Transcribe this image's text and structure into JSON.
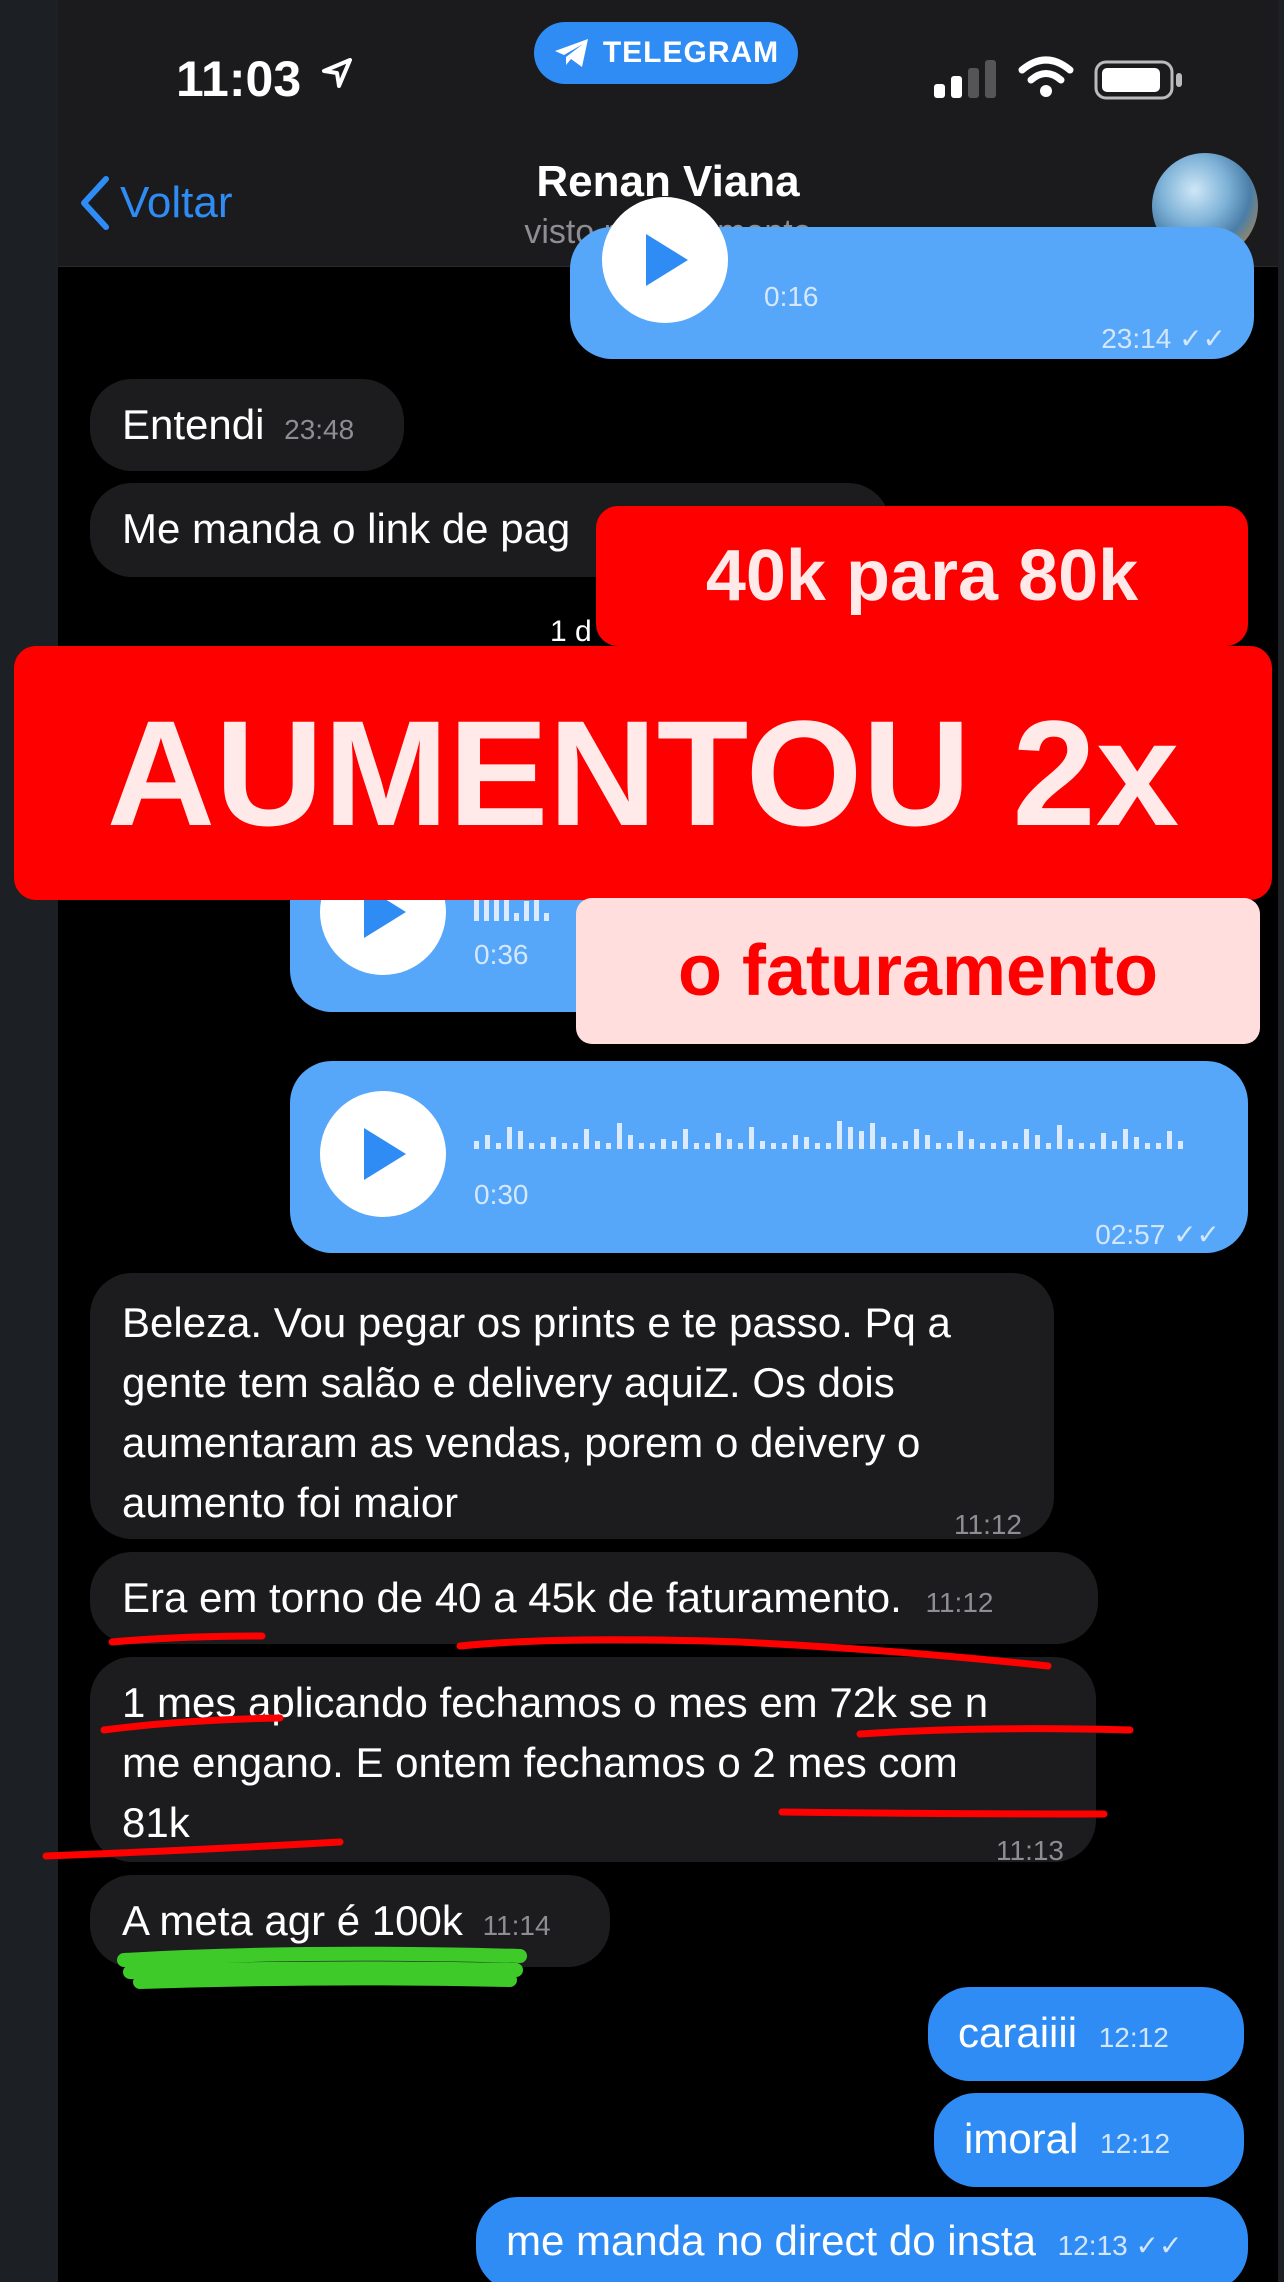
{
  "status_bar": {
    "time": "11:03",
    "telegram_pill": "TELEGRAM"
  },
  "header": {
    "back_label": "Voltar",
    "contact_name": "Renan Viana",
    "contact_status": "visto recentemente"
  },
  "messages": {
    "voice_top": {
      "duration": "0:16",
      "time": "23:14"
    },
    "entendi": {
      "text": "Entendi",
      "time": "23:48"
    },
    "link": {
      "text": "Me manda o link de pag"
    },
    "date_partial": "1 d",
    "voice_a": {
      "duration": "0:36"
    },
    "voice_b": {
      "duration": "0:30",
      "time": "02:57"
    },
    "beleza": {
      "lines": [
        "Beleza. Vou pegar os prints e te passo. Pq a",
        "gente tem salão e delivery aquiZ. Os dois",
        "aumentaram as vendas, porem o deivery o",
        "aumento foi maior"
      ],
      "time": "11:12"
    },
    "era": {
      "text": "Era em torno de 40 a 45k de faturamento.",
      "time": "11:12"
    },
    "mes": {
      "lines": [
        "1 mes aplicando fechamos o mes em 72k se n",
        "me engano. E ontem fechamos o 2 mes com",
        "81k"
      ],
      "time": "11:13"
    },
    "meta": {
      "text": "A meta agr é 100k",
      "time": "11:14"
    },
    "caraiiii": {
      "text": "caraiiii",
      "time": "12:12"
    },
    "imoral": {
      "text": "imoral",
      "time": "12:12"
    },
    "direct": {
      "text": "me manda no direct do insta",
      "time": "12:13"
    }
  },
  "overlay": {
    "top_banner": "40k para 80k",
    "main_banner": "AUMENTOU 2x",
    "bottom_banner": "o faturamento"
  },
  "colors": {
    "accent": "#2f8cf5",
    "banner_red": "#ff0000",
    "underline_red": "#ff0000",
    "highlight_green": "#3ecb2a"
  }
}
